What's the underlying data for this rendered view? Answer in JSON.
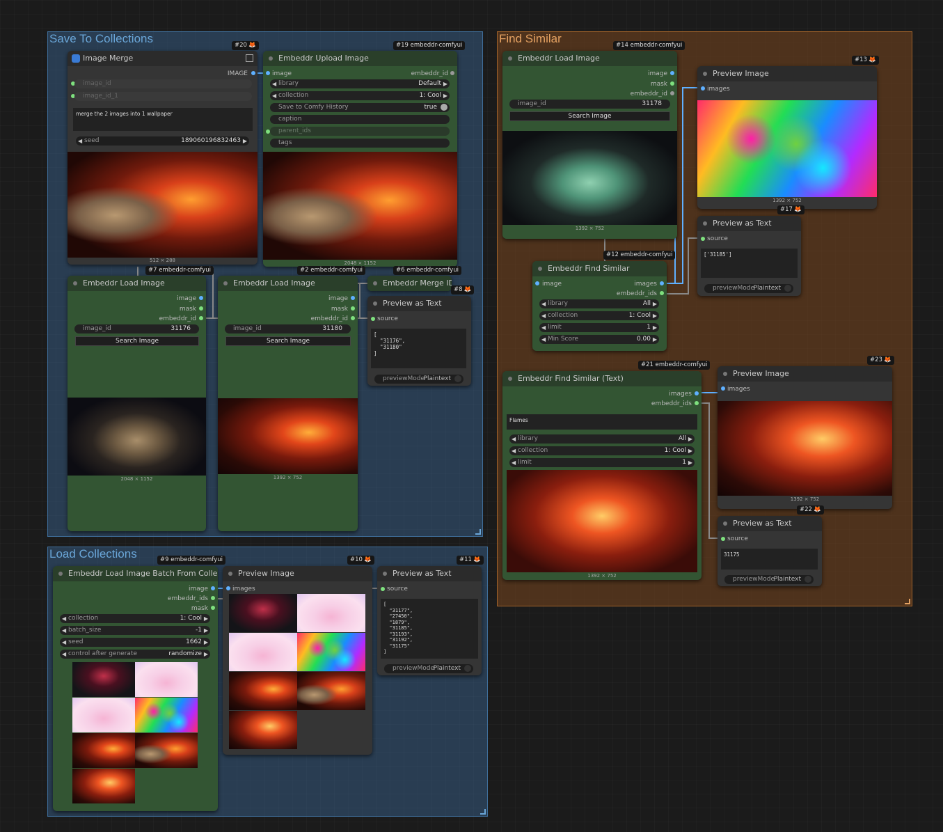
{
  "groups": {
    "save": "Save To Collections",
    "find": "Find Similar",
    "load": "Load Collections"
  },
  "nodes": {
    "n20": {
      "badge": "#20",
      "title": "Image Merge",
      "out_image": "IMAGE",
      "in_image_id": "image_id",
      "in_image_id_1": "image_id_1",
      "text": "merge the 2 images into 1 wallpaper",
      "seed_label": "seed",
      "seed_value": "189060196832463",
      "dims": "512 × 288"
    },
    "n19": {
      "badge": "#19 embeddr-comfyui",
      "title": "Embeddr Upload Image",
      "in_image": "image",
      "out_embeddr_id": "embeddr_id",
      "library_label": "library",
      "library_value": "Default",
      "collection_label": "collection",
      "collection_value": "1: Cool",
      "save_label": "Save to Comfy History",
      "save_value": "true",
      "caption_label": "caption",
      "parent_ids_label": "parent_ids",
      "tags_label": "tags",
      "dims": "2048 × 1152"
    },
    "n7": {
      "badge": "#7 embeddr-comfyui",
      "title": "Embeddr Load Image",
      "out_image": "image",
      "out_mask": "mask",
      "out_embeddr_id": "embeddr_id",
      "image_id_label": "image_id",
      "image_id_value": "31176",
      "search": "Search Image",
      "dims": "2048 × 1152"
    },
    "n2": {
      "badge": "#2 embeddr-comfyui",
      "title": "Embeddr Load Image",
      "out_image": "image",
      "out_mask": "mask",
      "out_embeddr_id": "embeddr_id",
      "image_id_label": "image_id",
      "image_id_value": "31180",
      "search": "Search Image",
      "dims": "1392 × 752"
    },
    "n6": {
      "badge": "#6 embeddr-comfyui",
      "title": "Embeddr Merge IDs"
    },
    "n8": {
      "badge": "#8",
      "title": "Preview as Text",
      "in_source": "source",
      "text": "[\n  \"31176\",\n  \"31180\"\n]",
      "mode_label": "previewMode",
      "mode_value": "Plaintext"
    },
    "n14": {
      "badge": "#14 embeddr-comfyui",
      "title": "Embeddr Load Image",
      "out_image": "image",
      "out_mask": "mask",
      "out_embeddr_id": "embeddr_id",
      "image_id_label": "image_id",
      "image_id_value": "31178",
      "search": "Search Image",
      "dims": "1392 × 752"
    },
    "n13": {
      "badge": "#13",
      "title": "Preview Image",
      "in_images": "images",
      "dims": "1392 × 752"
    },
    "n17": {
      "badge": "#17",
      "title": "Preview as Text",
      "in_source": "source",
      "text": "['31185']",
      "mode_label": "previewMode",
      "mode_value": "Plaintext"
    },
    "n12": {
      "badge": "#12 embeddr-comfyui",
      "title": "Embeddr Find Similar",
      "in_image": "image",
      "out_images": "images",
      "out_embeddr_ids": "embeddr_ids",
      "library_label": "library",
      "library_value": "All",
      "collection_label": "collection",
      "collection_value": "1: Cool",
      "limit_label": "limit",
      "limit_value": "1",
      "minscore_label": "Min Score",
      "minscore_value": "0.00"
    },
    "n21": {
      "badge": "#21 embeddr-comfyui",
      "title": "Embeddr Find Similar (Text)",
      "out_images": "images",
      "out_embeddr_ids": "embeddr_ids",
      "text": "Flames",
      "library_label": "library",
      "library_value": "All",
      "collection_label": "collection",
      "collection_value": "1: Cool",
      "limit_label": "limit",
      "limit_value": "1",
      "dims": "1392 × 752"
    },
    "n23": {
      "badge": "#23",
      "title": "Preview Image",
      "in_images": "images",
      "dims": "1392 × 752"
    },
    "n22": {
      "badge": "#22",
      "title": "Preview as Text",
      "in_source": "source",
      "text": "31175",
      "mode_label": "previewMode",
      "mode_value": "Plaintext"
    },
    "n9": {
      "badge": "#9 embeddr-comfyui",
      "title": "Embeddr Load Image Batch From Colle...",
      "out_image": "image",
      "out_embeddr_ids": "embeddr_ids",
      "out_mask": "mask",
      "collection_label": "collection",
      "collection_value": "1: Cool",
      "batch_label": "batch_size",
      "batch_value": "-1",
      "seed_label": "seed",
      "seed_value": "1662",
      "cag_label": "control after generate",
      "cag_value": "randomize"
    },
    "n10": {
      "badge": "#10",
      "title": "Preview Image",
      "in_images": "images"
    },
    "n11": {
      "badge": "#11",
      "title": "Preview as Text",
      "in_source": "source",
      "text": "[\n  \"31177\",\n  \"27450\",\n  \"1879\",\n  \"31185\",\n  \"31193\",\n  \"31192\",\n  \"31175\"\n]",
      "mode_label": "previewMode",
      "mode_value": "Plaintext"
    }
  },
  "icons": {
    "fox": "fox-icon",
    "node_dot": "status-dot-icon",
    "arrow_left": "◀",
    "arrow_right": "▶"
  },
  "colors": {
    "node_green": "#335533",
    "node_gray": "#353535",
    "group_blue": "#3b6996",
    "group_orange": "#78461e",
    "wire_blue": "#5fb0ff",
    "slot_green": "#7ee07e"
  }
}
